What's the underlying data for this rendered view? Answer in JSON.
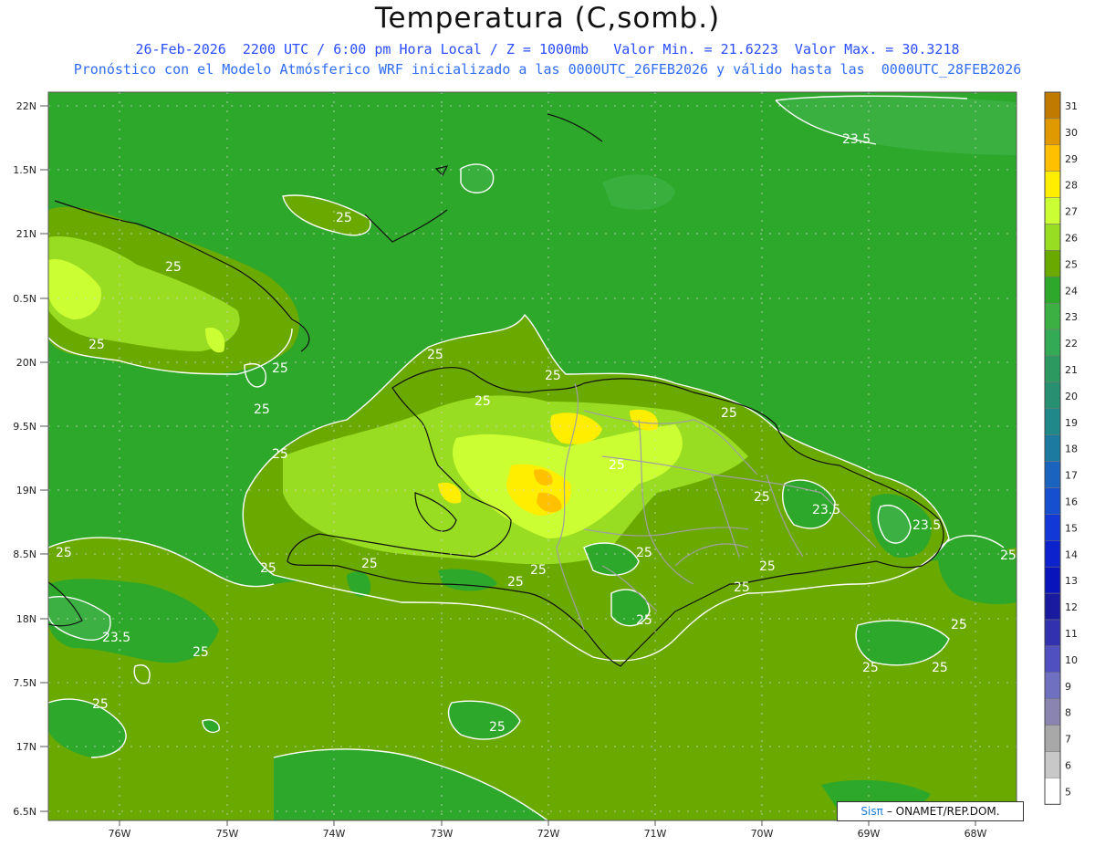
{
  "header": {
    "title": "Temperatura (C,somb.)",
    "line1": "26-Feb-2026  2200 UTC / 6:00 pm Hora Local / Z = 1000mb   Valor Min. = 21.6223  Valor Max. = 30.3218",
    "line2": "Pronóstico con el Modelo Atmósferico WRF inicializado a las 0000UTC_26FEB2026 y válido hasta las  0000UTC_28FEB2026"
  },
  "axes": {
    "lat_labels": [
      "22N",
      "1.5N",
      "21N",
      "0.5N",
      "20N",
      "9.5N",
      "19N",
      "8.5N",
      "18N",
      "7.5N",
      "17N",
      "6.5N"
    ],
    "lon_labels": [
      "76W",
      "75W",
      "74W",
      "73W",
      "72W",
      "71W",
      "70W",
      "69W",
      "68W"
    ]
  },
  "contours": {
    "labels": [
      "25",
      "25",
      "25",
      "25",
      "25",
      "25",
      "25",
      "25",
      "25",
      "25",
      "25",
      "25",
      "25",
      "25",
      "25",
      "25",
      "25",
      "25",
      "25",
      "25",
      "25",
      "25",
      "25",
      "23.5",
      "23.5",
      "23.5",
      "23.5",
      "25",
      "25"
    ]
  },
  "colorbar": {
    "labels": [
      "31",
      "30",
      "29",
      "28",
      "27",
      "26",
      "25",
      "24",
      "23",
      "22",
      "21",
      "20",
      "19",
      "18",
      "17",
      "16",
      "15",
      "14",
      "13",
      "12",
      "11",
      "10",
      "9",
      "8",
      "7",
      "6",
      "5"
    ],
    "colors": [
      "#c07a00",
      "#e09a00",
      "#ffc000",
      "#ffee00",
      "#ccff33",
      "#99dd22",
      "#6aaa00",
      "#2ea82a",
      "#3cb043",
      "#33aa55",
      "#2c9960",
      "#289070",
      "#208888",
      "#1c7aa0",
      "#1a64c0",
      "#1650d0",
      "#1238d8",
      "#0c22cc",
      "#0a14bb",
      "#1a1aa0",
      "#3232b0",
      "#5050c0",
      "#7070c0",
      "#8a84b0",
      "#a8a8a8",
      "#c8c8c8",
      "#ffffff"
    ]
  },
  "credit": {
    "brand": "Sisπ",
    "text": "– ONAMET/REP.DOM."
  }
}
